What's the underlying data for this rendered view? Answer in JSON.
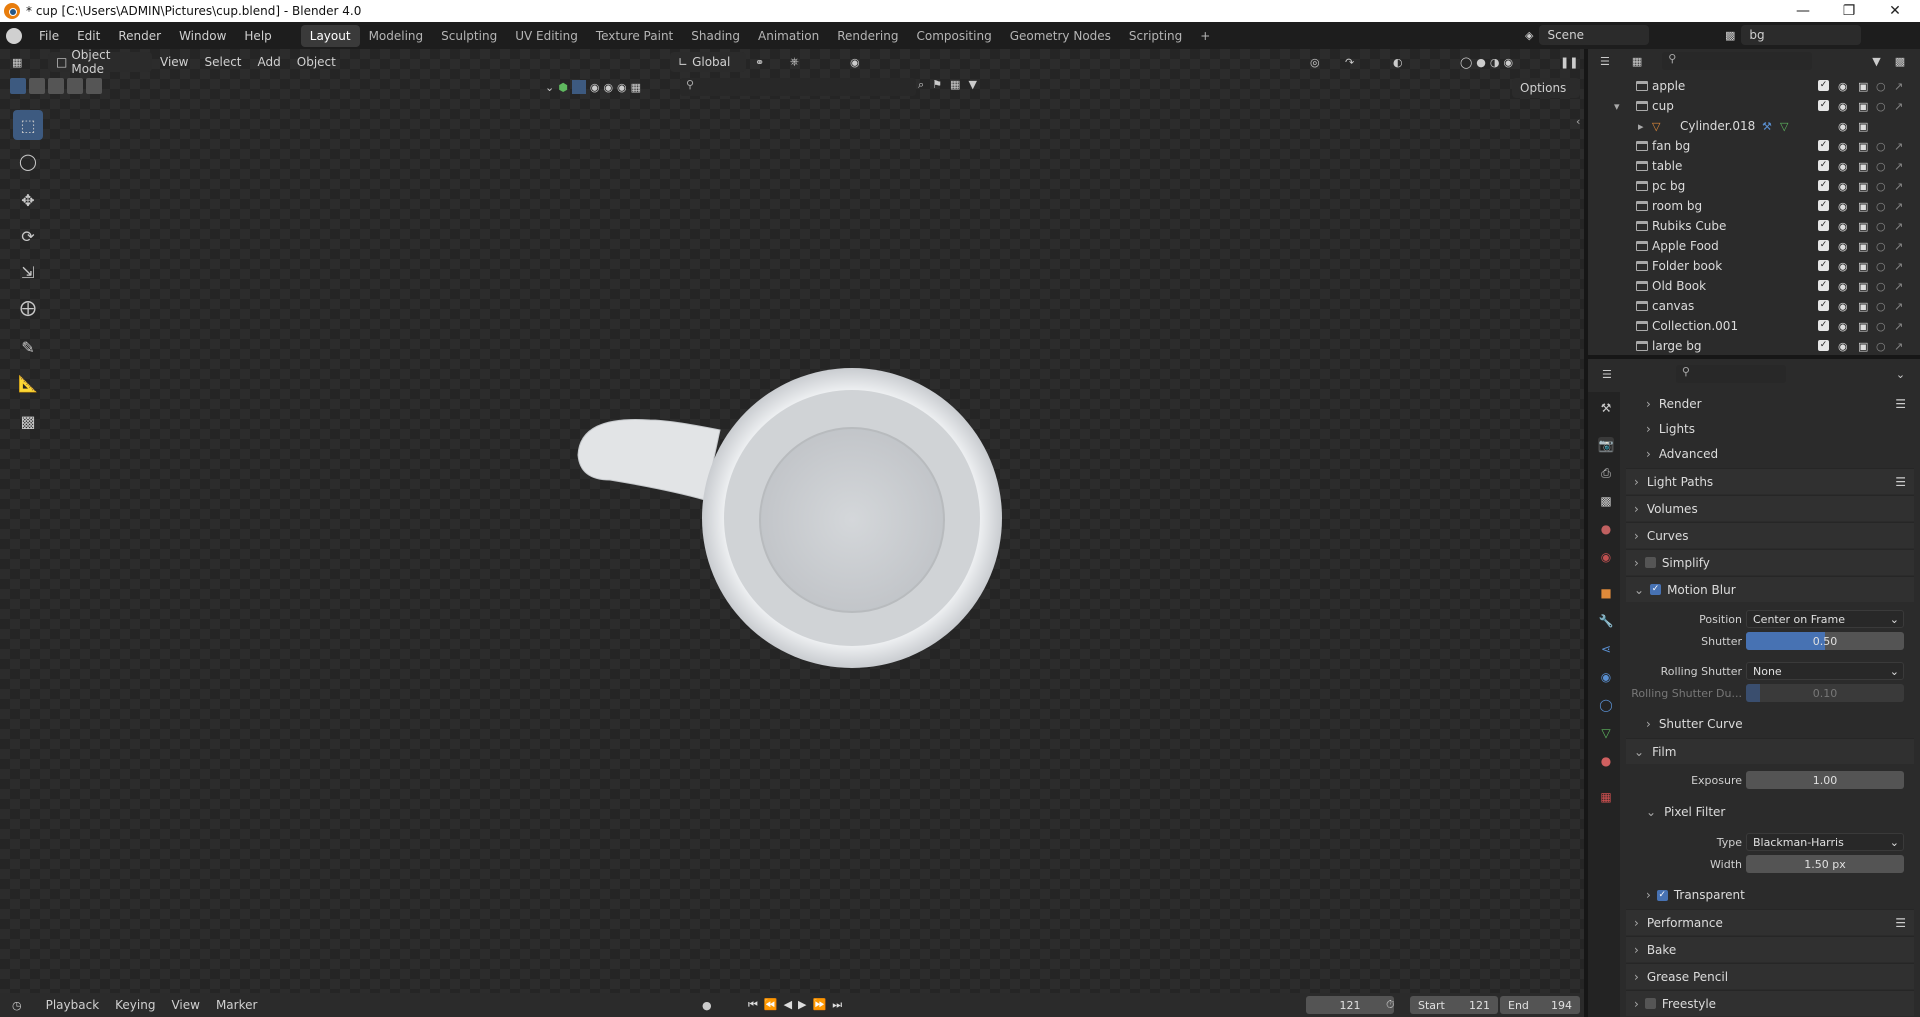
{
  "window": {
    "title": "* cup [C:\\Users\\ADMIN\\Pictures\\cup.blend] - Blender 4.0"
  },
  "menu": {
    "items": [
      "File",
      "Edit",
      "Render",
      "Window",
      "Help"
    ]
  },
  "workspaces": [
    "Layout",
    "Modeling",
    "Sculpting",
    "UV Editing",
    "Texture Paint",
    "Shading",
    "Animation",
    "Rendering",
    "Compositing",
    "Geometry Nodes",
    "Scripting"
  ],
  "active_workspace": "Layout",
  "scene": {
    "name": "Scene",
    "view_layer": "bg"
  },
  "viewport_header": {
    "mode": "Object Mode",
    "menus": [
      "View",
      "Select",
      "Add",
      "Object"
    ],
    "orientation": "Global",
    "options": "Options"
  },
  "outliner": {
    "rows": [
      {
        "name": "apple",
        "expanded": false,
        "indent": 0
      },
      {
        "name": "cup",
        "expanded": true,
        "indent": 0
      },
      {
        "name": "Cylinder.018",
        "expanded": false,
        "indent": 1,
        "type": "mesh"
      },
      {
        "name": "fan bg",
        "indent": 0
      },
      {
        "name": "table",
        "indent": 0
      },
      {
        "name": "pc bg",
        "indent": 0
      },
      {
        "name": "room bg",
        "indent": 0
      },
      {
        "name": "Rubiks Cube",
        "indent": 0
      },
      {
        "name": "Apple Food",
        "indent": 0
      },
      {
        "name": "Folder book",
        "indent": 0
      },
      {
        "name": "Old Book",
        "indent": 0
      },
      {
        "name": "canvas",
        "indent": 0
      },
      {
        "name": "Collection.001",
        "indent": 0
      },
      {
        "name": "large  bg",
        "indent": 0
      }
    ]
  },
  "properties": {
    "sub_render": "Render",
    "sub_lights": "Lights",
    "sub_advanced": "Advanced",
    "light_paths": "Light Paths",
    "volumes": "Volumes",
    "curves": "Curves",
    "simplify": "Simplify",
    "motion_blur": "Motion Blur",
    "position_label": "Position",
    "position_value": "Center on Frame",
    "shutter_label": "Shutter",
    "shutter_value": "0.50",
    "shutter_fraction": 0.5,
    "rolling_label": "Rolling Shutter",
    "rolling_value": "None",
    "rolling_dur_label": "Rolling Shutter Du...",
    "rolling_dur_value": "0.10",
    "shutter_curve": "Shutter Curve",
    "film": "Film",
    "exposure_label": "Exposure",
    "exposure_value": "1.00",
    "pixel_filter": "Pixel Filter",
    "type_label": "Type",
    "type_value": "Blackman-Harris",
    "width_label": "Width",
    "width_value": "1.50 px",
    "transparent": "Transparent",
    "performance": "Performance",
    "bake": "Bake",
    "grease_pencil": "Grease Pencil",
    "freestyle": "Freestyle"
  },
  "timeline": {
    "menus": [
      "Playback",
      "Keying",
      "View",
      "Marker"
    ],
    "current_frame": "121",
    "start_label": "Start",
    "start_value": "121",
    "end_label": "End",
    "end_value": "194"
  }
}
